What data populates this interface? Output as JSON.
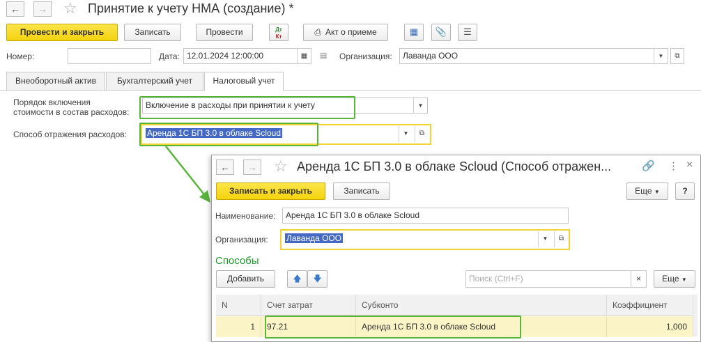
{
  "window": {
    "title": "Принятие к учету НМА (создание) *"
  },
  "toolbar": {
    "post_close": "Провести и закрыть",
    "save": "Записать",
    "post": "Провести",
    "dt_kt_label_top": "Дт",
    "dt_kt_label_bottom": "Кт",
    "act": "Акт о приеме"
  },
  "header_fields": {
    "number_label": "Номер:",
    "number_value": "",
    "date_label": "Дата:",
    "date_value": "12.01.2024 12:00:00",
    "org_label": "Организация:",
    "org_value": "Лаванда ООО"
  },
  "tabs": [
    {
      "label": "Внеоборотный актив"
    },
    {
      "label": "Бухгалтерский учет"
    },
    {
      "label": "Налоговый учет"
    }
  ],
  "tax_tab": {
    "order_label_line1": "Порядок включения",
    "order_label_line2": "стоимости в состав расходов:",
    "order_value": "Включение в расходы при принятии к учету",
    "method_label": "Способ отражения расходов:",
    "method_value": "Аренда 1С БП 3.0 в облаке Scloud"
  },
  "modal": {
    "title": "Аренда 1С БП 3.0 в облаке Scloud (Способ отражен...",
    "save_close": "Записать и закрыть",
    "save": "Записать",
    "more": "Еще",
    "help": "?",
    "name_label": "Наименование:",
    "name_value": "Аренда 1С БП 3.0 в облаке Scloud",
    "org_label": "Организация:",
    "org_value": "Лаванда ООО",
    "section_title": "Способы",
    "add": "Добавить",
    "search_placeholder": "Поиск (Ctrl+F)",
    "search_clear": "×",
    "more2": "Еще",
    "columns": [
      "N",
      "Счет затрат",
      "Субконто",
      "Коэффициент"
    ],
    "rows": [
      {
        "n": "1",
        "account": "97.21",
        "subconto": "Аренда 1С БП 3.0 в облаке Scloud",
        "coef": "1,000"
      }
    ]
  },
  "colors": {
    "accent_yellow": "#f4d20e",
    "highlight_green": "#59b43c",
    "selection_blue": "#4469c4",
    "section_green": "#1e9c2c"
  },
  "icons": {
    "back": "arrow-left-icon",
    "forward": "arrow-right-icon",
    "favorite": "star-icon",
    "link": "link-icon",
    "menu": "more-vertical-icon",
    "close": "close-icon"
  }
}
